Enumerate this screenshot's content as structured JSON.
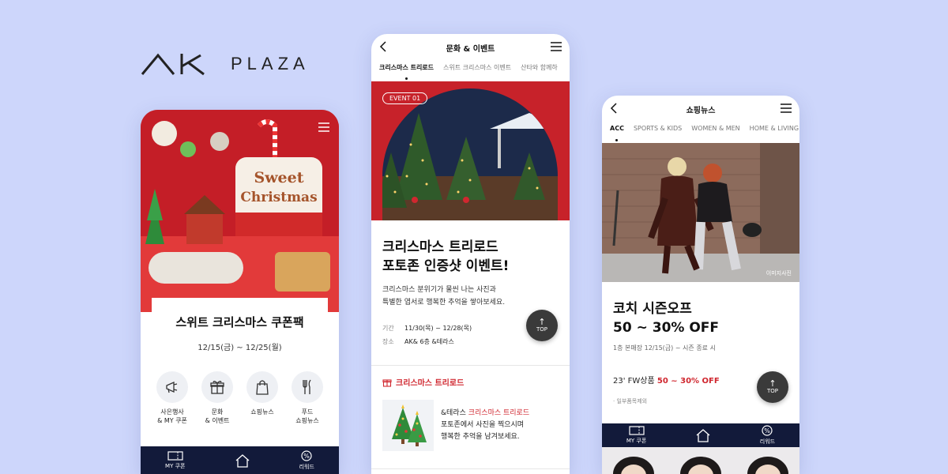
{
  "logo": {
    "text": "PLAZA"
  },
  "phone1": {
    "coupon_title": "스위트 크리스마스 쿠폰팩",
    "coupon_date": "12/15(금) ~ 12/25(월)",
    "quick_menu": [
      {
        "label": "사은행사\n& MY 쿠폰",
        "icon": "megaphone-icon"
      },
      {
        "label": "문화\n& 이벤트",
        "icon": "gift-icon"
      },
      {
        "label": "쇼핑뉴스",
        "icon": "shopping-bag-icon"
      },
      {
        "label": "푸드\n쇼핑뉴스",
        "icon": "fork-knife-icon"
      }
    ],
    "tabbar": [
      {
        "label": "MY 쿠폰",
        "icon": "ticket-icon"
      },
      {
        "label": "",
        "icon": "home-icon"
      },
      {
        "label": "리워드",
        "icon": "percent-icon"
      }
    ]
  },
  "phone2": {
    "header_title": "문화 & 이벤트",
    "tabs": [
      "크리스마스 트리로드",
      "스위트 크리스마스 이벤트",
      "산타와 함께하"
    ],
    "event_badge": "EVENT 01",
    "event_title_line1": "크리스마스 트리로드",
    "event_title_line2": "포토존 인증샷 이벤트!",
    "event_desc_line1": "크리스마스 분위기가 물씬 나는 사진과",
    "event_desc_line2": "특별한 엽서로 행복한 추억을 쌓아보세요.",
    "period_label": "기간",
    "period_value": "11/30(목) ~ 12/28(목)",
    "place_label": "장소",
    "place_value": "AK& 6층 &테라스",
    "top_label": "TOP",
    "section_title": "크리스마스 트리로드",
    "promo_prefix": "&테라스 ",
    "promo_highlight": "크리스마스 트리로드",
    "promo_line2": "포토존에서 사진을 찍으시며",
    "promo_line3": "행복한 추억을 남겨보세요."
  },
  "phone3": {
    "header_title": "쇼핑뉴스",
    "tabs": [
      "ACC",
      "SPORTS & KIDS",
      "WOMEN & MEN",
      "HOME & LIVING"
    ],
    "image_caption": "이미지사진",
    "title_line1": "코치 시즌오프",
    "title_line2": "50 ~ 30% OFF",
    "info": "1층 본매장  12/15(금) ~ 시즌 종료 시",
    "price_prefix": "23' FW상품 ",
    "price_highlight": "50 ~ 30% OFF",
    "note": "· 일부품목제외",
    "top_label": "TOP",
    "tabbar": [
      {
        "label": "MY 쿠폰",
        "icon": "ticket-icon"
      },
      {
        "label": "",
        "icon": "home-icon"
      },
      {
        "label": "리워드",
        "icon": "percent-icon"
      }
    ]
  },
  "colors": {
    "background": "#cdd6fb",
    "accent_red": "#d0272f",
    "navy": "#121a3a"
  }
}
